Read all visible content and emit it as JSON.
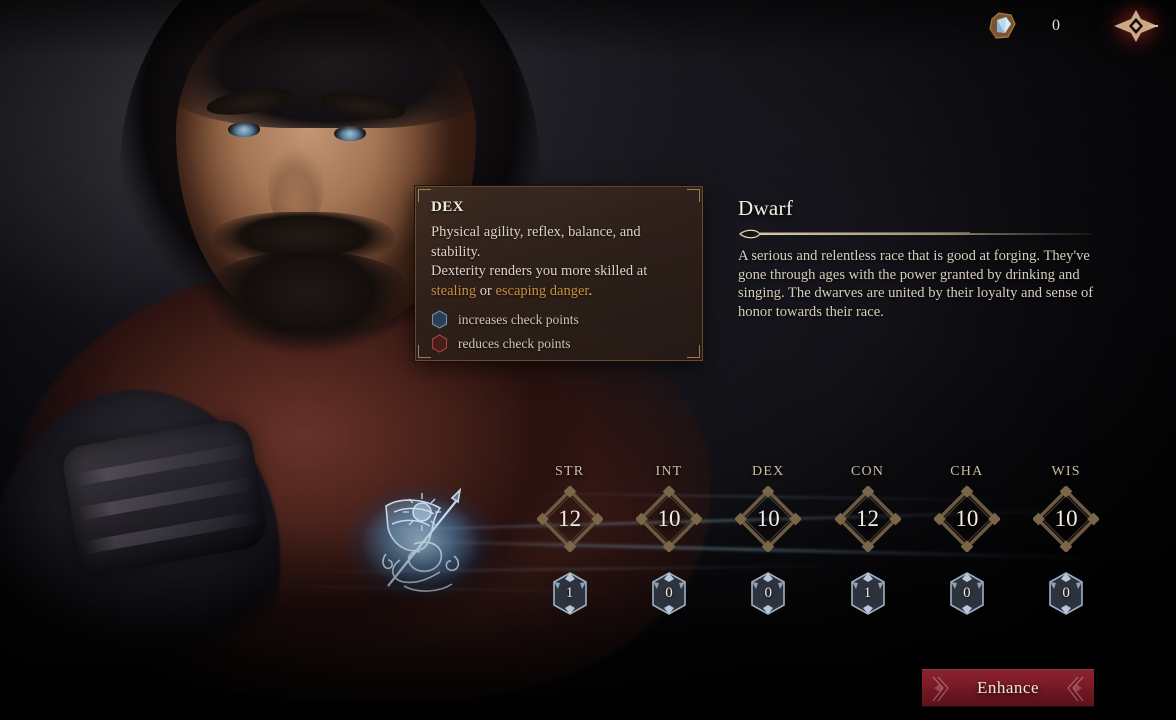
{
  "topbar": {
    "gem_icon": "gem-shard-icon",
    "currency_value": "0",
    "corner_emblem_icon": "faction-emblem-icon",
    "accent_red": "#7a1c28"
  },
  "tooltip": {
    "title": "DEX",
    "line1": "Physical agility, reflex, balance, and stability.",
    "line2_prefix": "Dexterity renders you more skilled at ",
    "highlight1": "stealing",
    "line2_mid": " or ",
    "highlight2": "escaping danger",
    "line2_suffix": ".",
    "highlight_color": "#c98f3a",
    "legend": [
      {
        "icon": "blue-hexagon-icon",
        "label": "increases check points",
        "color": "#3d5f85"
      },
      {
        "icon": "red-hexagon-icon",
        "label": "reduces check points",
        "color": "#8a3430"
      }
    ]
  },
  "race_panel": {
    "title": "Dwarf",
    "divider_icon": "ornamental-divider",
    "description": "A serious and relentless race that is good at forging. They've gone through ages with the power granted by drinking and singing. The dwarves are united by their loyalty and sense of honor towards their race."
  },
  "stats": {
    "columns": [
      {
        "label": "STR",
        "value": "12",
        "modifier": "1"
      },
      {
        "label": "INT",
        "value": "10",
        "modifier": "0"
      },
      {
        "label": "DEX",
        "value": "10",
        "modifier": "0"
      },
      {
        "label": "CON",
        "value": "12",
        "modifier": "1"
      },
      {
        "label": "CHA",
        "value": "10",
        "modifier": "0"
      },
      {
        "label": "WIS",
        "value": "10",
        "modifier": "0"
      }
    ]
  },
  "character": {
    "portrait_name": "dwarf-character-portrait",
    "emblem_icon": "banner-spear-sun-emblem"
  },
  "actions": {
    "enhance_label": "Enhance"
  }
}
